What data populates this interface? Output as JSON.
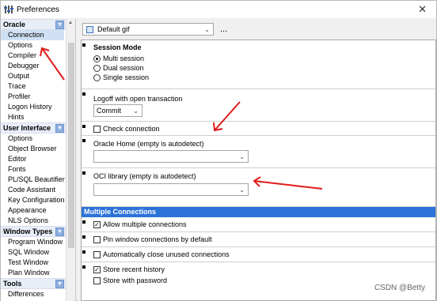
{
  "window": {
    "title": "Preferences",
    "close_glyph": "✕"
  },
  "nav": {
    "groups": [
      {
        "label": "Oracle",
        "items": [
          "Connection",
          "Options",
          "Compiler",
          "Debugger",
          "Output",
          "Trace",
          "Profiler",
          "Logon History",
          "Hints"
        ]
      },
      {
        "label": "User Interface",
        "items": [
          "Options",
          "Object Browser",
          "Editor",
          "Fonts",
          "PL/SQL Beautifier",
          "Code Assistant",
          "Key Configuration",
          "Appearance",
          "NLS Options"
        ]
      },
      {
        "label": "Window Types",
        "items": [
          "Program Window",
          "SQL Window",
          "Test Window",
          "Plan Window"
        ]
      },
      {
        "label": "Tools",
        "items": [
          "Differences"
        ]
      }
    ],
    "selected": "Connection"
  },
  "profile": {
    "value": "Default gif",
    "menu_glyph": "..."
  },
  "session_mode": {
    "title": "Session Mode",
    "options": [
      "Multi session",
      "Dual session",
      "Single session"
    ],
    "selected": "Multi session"
  },
  "logoff": {
    "label": "Logoff with open transaction",
    "value": "Commit"
  },
  "check_connection": {
    "label": "Check connection",
    "checked": false
  },
  "oracle_home": {
    "label": "Oracle Home (empty is autodetect)",
    "value": ""
  },
  "oci_library": {
    "label": "OCI library (empty is autodetect)",
    "value": ""
  },
  "multiple_connections": {
    "header": "Multiple Connections",
    "allow": {
      "label": "Allow multiple connections",
      "checked": true
    },
    "pin": {
      "label": "Pin window connections by default",
      "checked": false
    },
    "auto_close": {
      "label": "Automatically close unused connections",
      "checked": false
    },
    "store_history": {
      "label": "Store recent history",
      "checked": true
    },
    "store_password": {
      "label": "Store with password",
      "checked": false
    }
  },
  "glyphs": {
    "check": "✓",
    "chevron": "⌄",
    "up": "▲",
    "down": "▼"
  },
  "watermark": "CSDN @Betty",
  "colors": {
    "section_header": "#2b73d8",
    "annotation_arrow": "#e01b1b",
    "selected_nav": "#cfe0f5"
  }
}
